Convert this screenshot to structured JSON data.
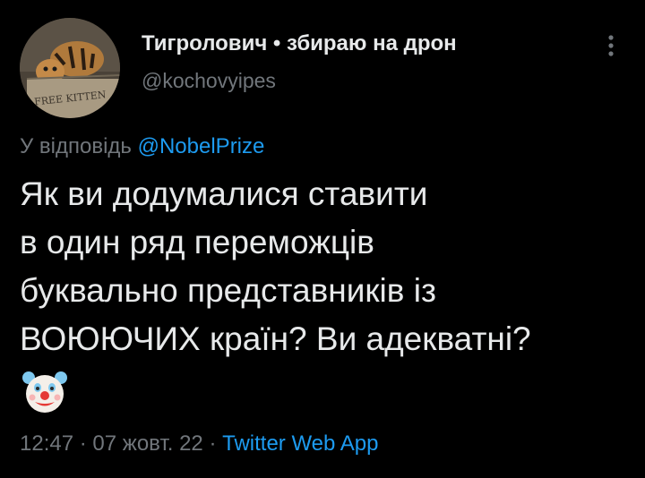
{
  "author": {
    "display_name": "Тигролович • збираю на дрон",
    "handle": "@kochovyipes",
    "avatar_sign_text": "FREE KITTEN"
  },
  "reply": {
    "prefix": "У відповідь",
    "mention": "@NobelPrize"
  },
  "tweet": {
    "lines": [
      "Як ви додумалися ставити",
      "в один ряд переможців",
      "буквально представників із",
      "ВОЮЮЧИХ країн? Ви адекватні?"
    ],
    "emoji": "clown-face"
  },
  "meta": {
    "time": "12:47",
    "separator": "·",
    "date": "07 жовт. 22",
    "source": "Twitter Web App"
  },
  "colors": {
    "background": "#000000",
    "text": "#e7e9ea",
    "secondary": "#71767b",
    "link": "#1d9bf0"
  },
  "icons": {
    "more": "vertical-ellipsis-icon"
  }
}
